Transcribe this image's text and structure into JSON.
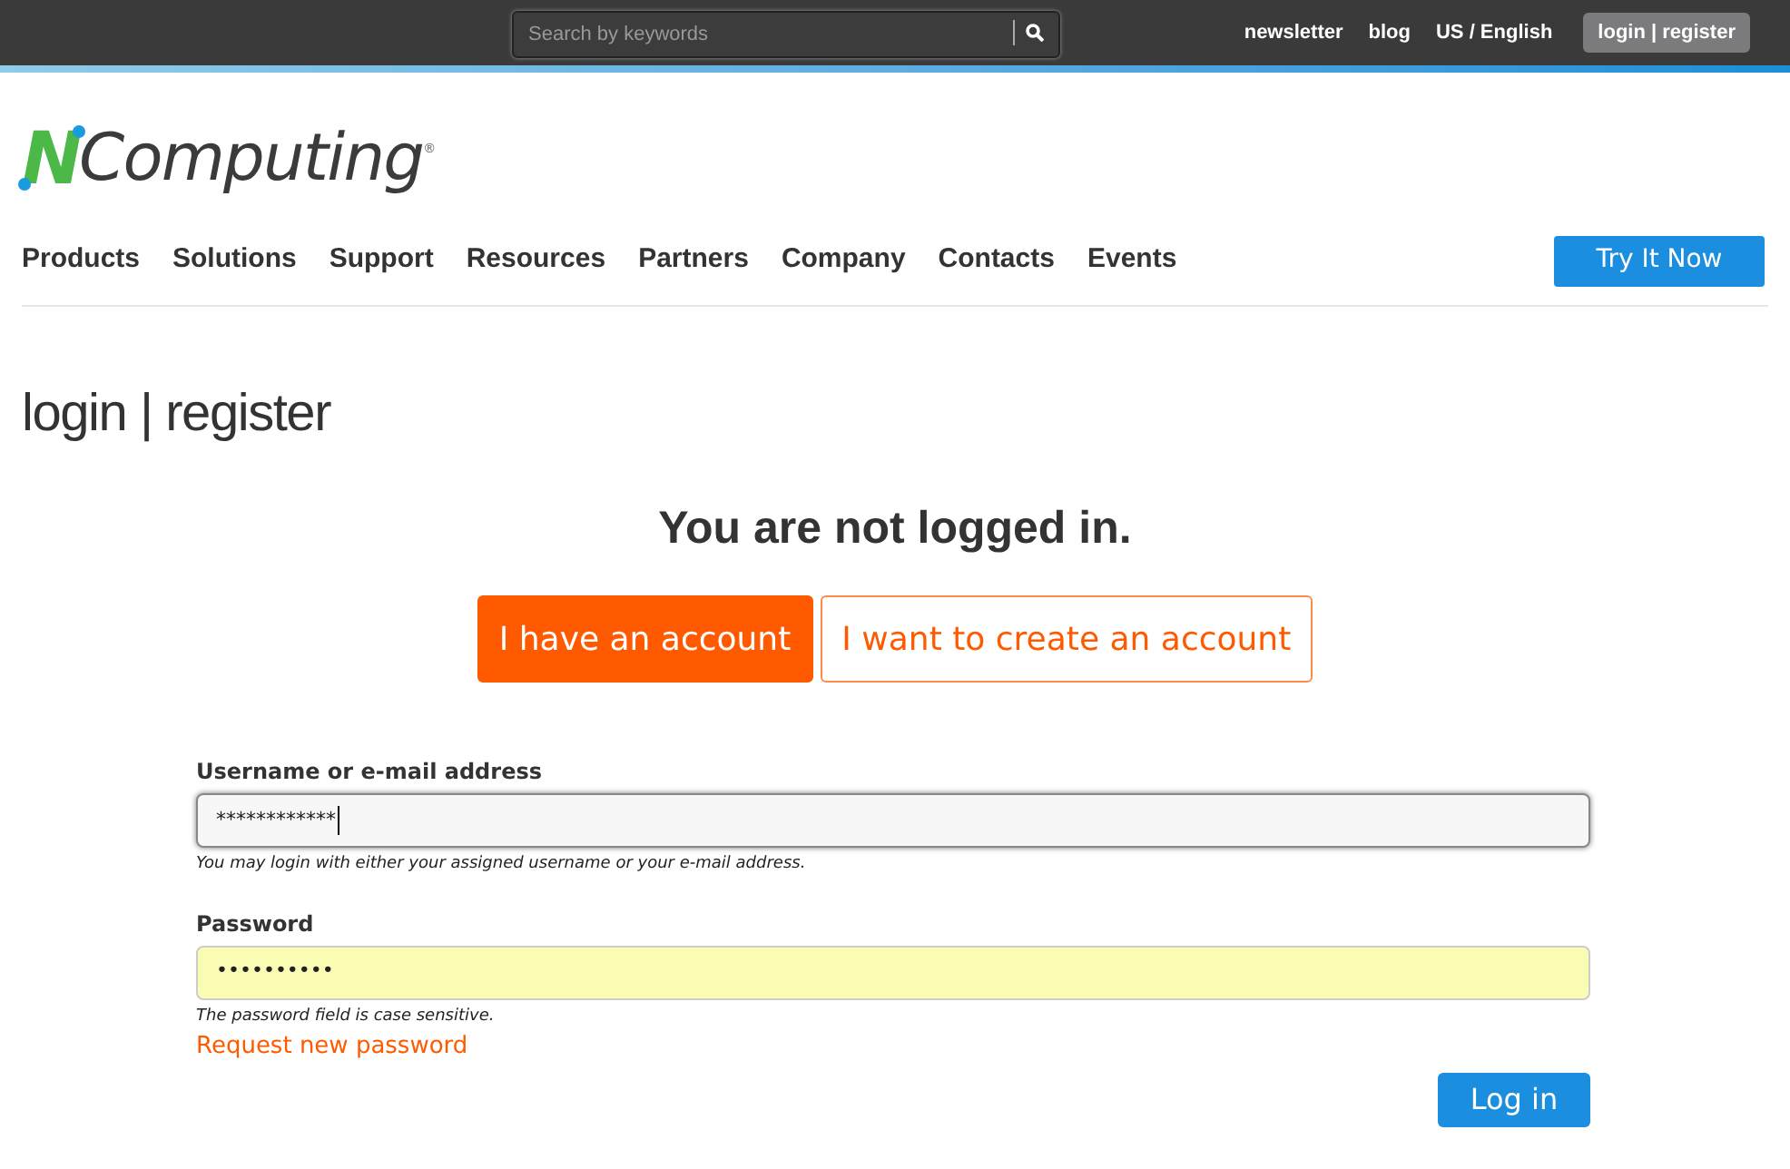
{
  "top_bar": {
    "search": {
      "placeholder": "Search by keywords"
    },
    "links": [
      "newsletter",
      "blog",
      "US / English"
    ],
    "account_button": "login | register"
  },
  "logo": {
    "lead": "N",
    "rest": "Computing",
    "mark": "®"
  },
  "nav": {
    "items": [
      "Products",
      "Solutions",
      "Support",
      "Resources",
      "Partners",
      "Company",
      "Contacts",
      "Events"
    ],
    "cta": "Try It Now"
  },
  "page_title": "login | register",
  "status_heading": "You are not logged in.",
  "tabs": [
    {
      "label": "I have an account",
      "selected": true
    },
    {
      "label": "I want to create an account",
      "selected": false
    }
  ],
  "form": {
    "fields": [
      {
        "label": "Username or e-mail address",
        "value": "************",
        "focused": true,
        "autofilled": false,
        "hint": "You may login with either your assigned username or your e-mail address."
      },
      {
        "label": "Password",
        "value": "••••••••••",
        "focused": false,
        "autofilled": true,
        "hint": "The password field is case sensitive."
      }
    ],
    "link": "Request new password",
    "submit": "Log in"
  }
}
